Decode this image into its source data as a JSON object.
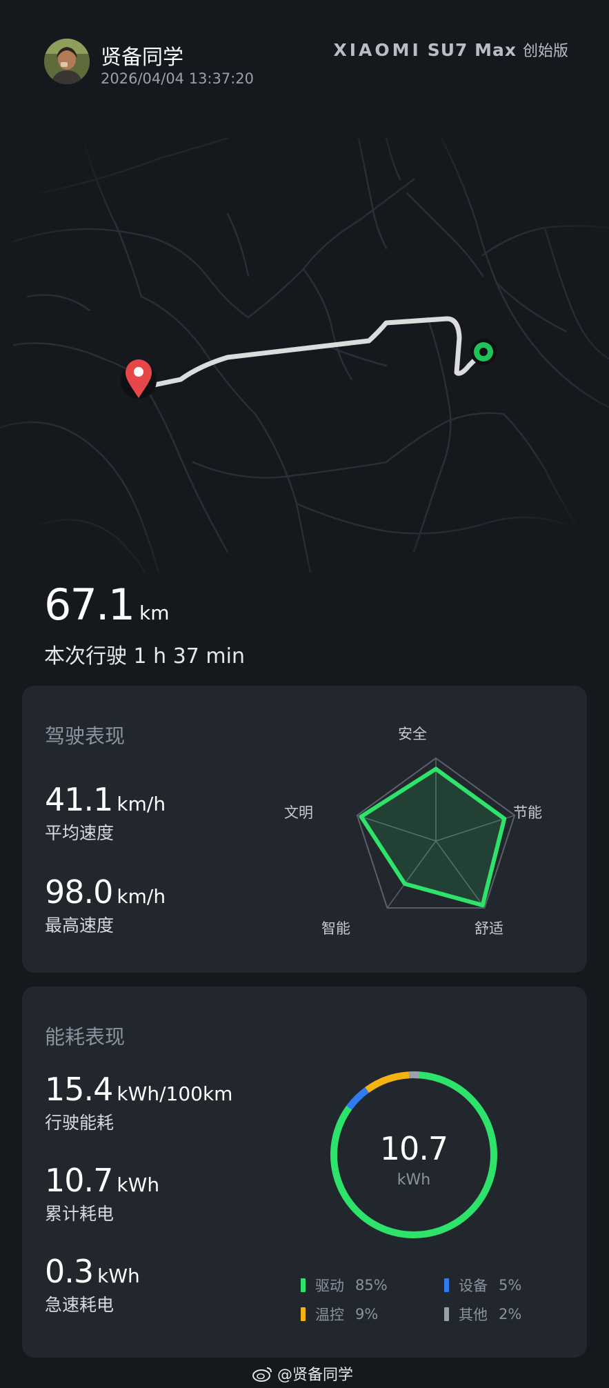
{
  "header": {
    "user_name": "贤备同学",
    "timestamp": "2026/04/04 13:37:20",
    "brand_logo": "XIAOMI",
    "brand_model": "SU7 Max",
    "brand_edition": "创始版"
  },
  "trip": {
    "distance_value": "67.1",
    "distance_unit": "km",
    "duration_text": "本次行驶 1 h 37 min"
  },
  "driving": {
    "title": "驾驶表现",
    "avg_speed_value": "41.1",
    "avg_speed_unit": "km/h",
    "avg_speed_label": "平均速度",
    "max_speed_value": "98.0",
    "max_speed_unit": "km/h",
    "max_speed_label": "最高速度",
    "radar": {
      "axes": [
        "安全",
        "节能",
        "舒适",
        "智能",
        "文明"
      ],
      "scores": [
        0.87,
        0.87,
        0.96,
        0.64,
        0.95
      ],
      "line_color": "#2de36a"
    }
  },
  "energy": {
    "title": "能耗表现",
    "consumption_value": "15.4",
    "consumption_unit": "kWh/100km",
    "consumption_label": "行驶能耗",
    "total_value": "10.7",
    "total_unit": "kWh",
    "total_label": "累计耗电",
    "accel_value": "0.3",
    "accel_unit": "kWh",
    "accel_label": "急速耗电",
    "donut_value": "10.7",
    "donut_unit": "kWh",
    "breakdown": [
      {
        "name": "驱动",
        "pct": "85%",
        "fraction": 0.85,
        "color": "#2de36a"
      },
      {
        "name": "设备",
        "pct": "5%",
        "fraction": 0.05,
        "color": "#2f7cf0"
      },
      {
        "name": "温控",
        "pct": "9%",
        "fraction": 0.09,
        "color": "#f5b312"
      },
      {
        "name": "其他",
        "pct": "2%",
        "fraction": 0.02,
        "color": "#9aa1ab"
      }
    ]
  },
  "watermark": "@贤备同学",
  "colors": {
    "background": "#15181d",
    "card": "#22262d",
    "route": "#d9d9d9",
    "start_marker": "#22c25a",
    "end_marker": "#e8474a"
  }
}
